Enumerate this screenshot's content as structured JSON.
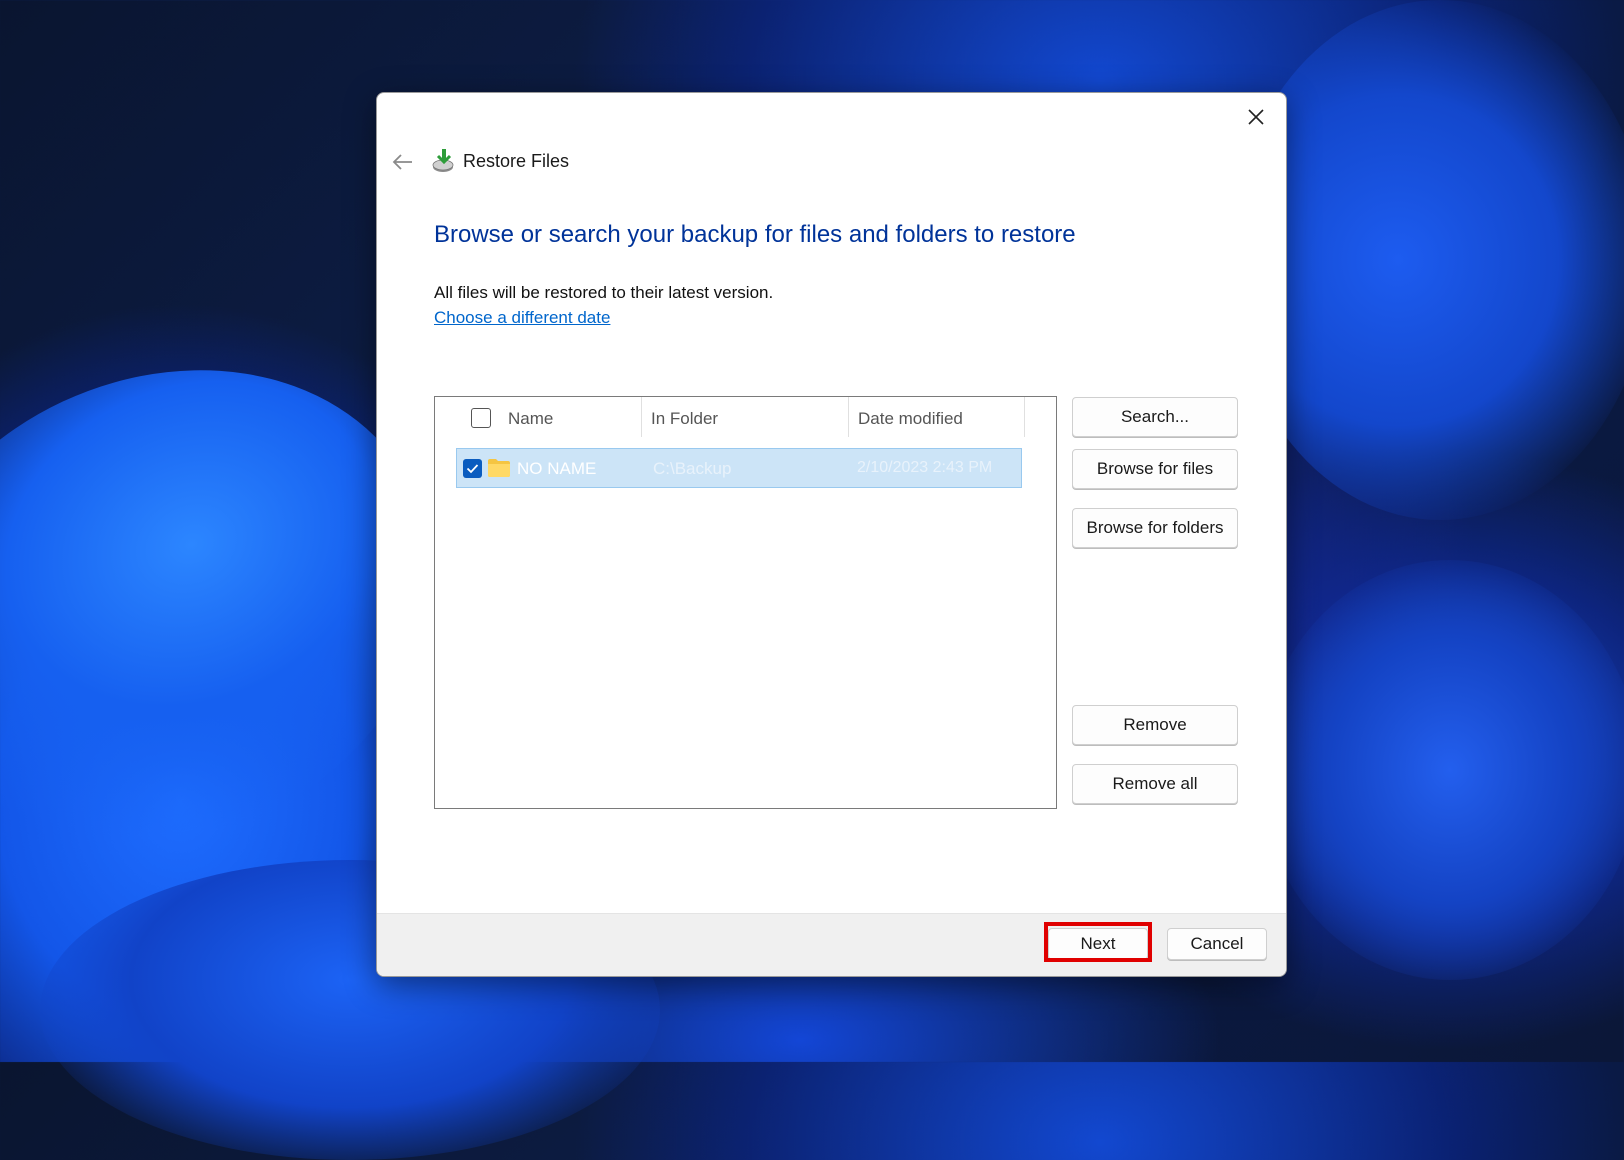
{
  "window": {
    "title": "Restore Files",
    "heading": "Browse or search your backup for files and folders to restore",
    "info_text": "All files will be restored to their latest version.",
    "date_link": "Choose a different date"
  },
  "list": {
    "columns": [
      "Name",
      "In Folder",
      "Date modified"
    ],
    "rows": [
      {
        "name": "NO NAME",
        "in_folder": "C:\\Backup",
        "date_modified": "2/10/2023 2:43 PM",
        "checked": true
      }
    ]
  },
  "side_buttons": {
    "search": "Search...",
    "browse_files": "Browse for files",
    "browse_folders": "Browse for folders",
    "remove": "Remove",
    "remove_all": "Remove all"
  },
  "footer": {
    "next": "Next",
    "cancel": "Cancel"
  },
  "colors": {
    "heading": "#003399",
    "link": "#0066cc",
    "selection": "#cce4f7",
    "highlight": "#e00000"
  }
}
